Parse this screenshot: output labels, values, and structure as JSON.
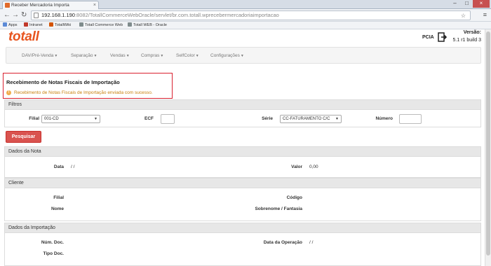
{
  "browser": {
    "tab_title": "Receber Mercadoria Importa",
    "url_host": "192.168.1.190",
    "url_path": ":8082/TotallCommerceWebOracle/servlet/br.com.totall.wprecebermercadoriaimportacao",
    "bookmarks": [
      {
        "label": "Apps",
        "color": "#5b8ad6"
      },
      {
        "label": "Intranet",
        "color": "#c0392b"
      },
      {
        "label": "TotallWiki",
        "color": "#d35400"
      },
      {
        "label": "Totall Commerce Web",
        "color": "#7f8c8d"
      },
      {
        "label": "Totall WEB - Oracle",
        "color": "#7f8c8d"
      }
    ]
  },
  "header": {
    "logo": "totall",
    "company": "PCIA",
    "version_label": "Versão:",
    "version_value": "5.1 r1 build 3"
  },
  "nav": [
    {
      "label": "DAV/Pré-Venda"
    },
    {
      "label": "Separação"
    },
    {
      "label": "Vendas"
    },
    {
      "label": "Compras"
    },
    {
      "label": "SelfColor"
    },
    {
      "label": "Configurações"
    }
  ],
  "page": {
    "title": "Recebimento de Notas Fiscais de Importação",
    "alert": "Recebimento de Notas Fiscais de Importação enviada com sucesso."
  },
  "filtros": {
    "heading": "Filtros",
    "filial_label": "Filial",
    "filial_value": "001-CD",
    "ecf_label": "ECF",
    "ecf_value": "",
    "serie_label": "Série",
    "serie_value": "CC-FATURAMENTO C/C",
    "numero_label": "Número",
    "numero_value": "",
    "search_button": "Pesquisar"
  },
  "dados_nota": {
    "heading": "Dados da Nota",
    "data_label": "Data",
    "data_value": "/ /",
    "valor_label": "Valor",
    "valor_value": "0,00"
  },
  "cliente": {
    "heading": "Cliente",
    "filial_label": "Filial",
    "codigo_label": "Código",
    "nome_label": "Nome",
    "sobrenome_label": "Sobrenome / Fantasia"
  },
  "importacao": {
    "heading": "Dados da Importação",
    "num_doc_label": "Núm. Doc.",
    "data_operacao_label": "Data da Operação",
    "data_operacao_value": "/ /",
    "tipo_doc_label": "Tipo Doc."
  },
  "colors": {
    "brand": "#e8551f",
    "highlight_border": "#d9202f",
    "alert_text": "#c87f0a",
    "search_button": "#d9534f"
  }
}
